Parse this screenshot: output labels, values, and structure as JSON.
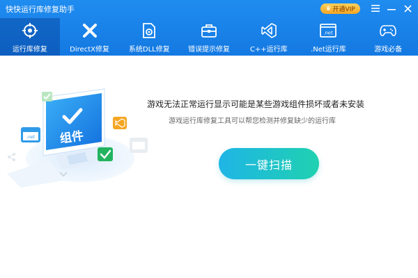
{
  "app": {
    "title": "快快运行库修复助手"
  },
  "titlebar": {
    "vip_label": "开通VIP",
    "menu_icon": "menu-icon",
    "minimize_icon": "minimize-icon",
    "close_icon": "close-icon"
  },
  "nav": {
    "items": [
      {
        "label": "运行库修复",
        "icon": "target-icon",
        "active": true
      },
      {
        "label": "DirectX修复",
        "icon": "directx-icon",
        "active": false
      },
      {
        "label": "系统DLL修复",
        "icon": "dll-gear-icon",
        "active": false
      },
      {
        "label": "错误提示修复",
        "icon": "toolbox-icon",
        "active": false
      },
      {
        "label": "C++运行库",
        "icon": "visual-studio-icon",
        "active": false
      },
      {
        "label": ".Net运行库",
        "icon": "dotnet-window-icon",
        "active": false
      },
      {
        "label": "游戏必备",
        "icon": "gamepad-icon",
        "active": false
      }
    ]
  },
  "main": {
    "headline": "游戏无法正常运行显示可能是某些游戏组件损坏或者未安装",
    "subtext": "游戏运行库修复工具可以帮您检测并修复缺少的运行库",
    "scan_button": "一键扫描",
    "illustration": {
      "screen_text": "组件",
      "net_badge": ".net"
    }
  },
  "colors": {
    "header": "#1479e2",
    "scan_gradient_start": "#1fb5e6",
    "scan_gradient_end": "#1fd1b0",
    "vip": "#f5a623"
  }
}
